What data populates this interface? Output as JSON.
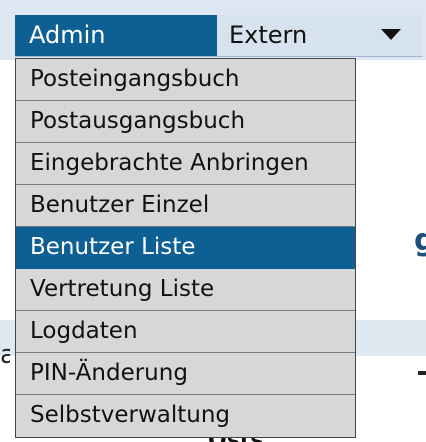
{
  "menubar": {
    "admin_label": "Admin",
    "extern_label": "Extern"
  },
  "dropdown": {
    "items": [
      {
        "label": "Posteingangsbuch",
        "active": false
      },
      {
        "label": "Postausgangsbuch",
        "active": false
      },
      {
        "label": "Eingebrachte Anbringen",
        "active": false
      },
      {
        "label": "Benutzer Einzel",
        "active": false
      },
      {
        "label": "Benutzer Liste",
        "active": true
      },
      {
        "label": "Vertretung Liste",
        "active": false
      },
      {
        "label": "Logdaten",
        "active": false
      },
      {
        "label": "PIN-Änderung",
        "active": false
      },
      {
        "label": "Selbstverwaltung",
        "active": false
      }
    ]
  },
  "background": {
    "left_glyph": "a",
    "right_glyph": "g",
    "bottom_text": "Osts"
  },
  "colors": {
    "accent": "#0e5f94",
    "menu_bg": "#d7d7d7",
    "extern_bg": "#d6e3ef"
  }
}
